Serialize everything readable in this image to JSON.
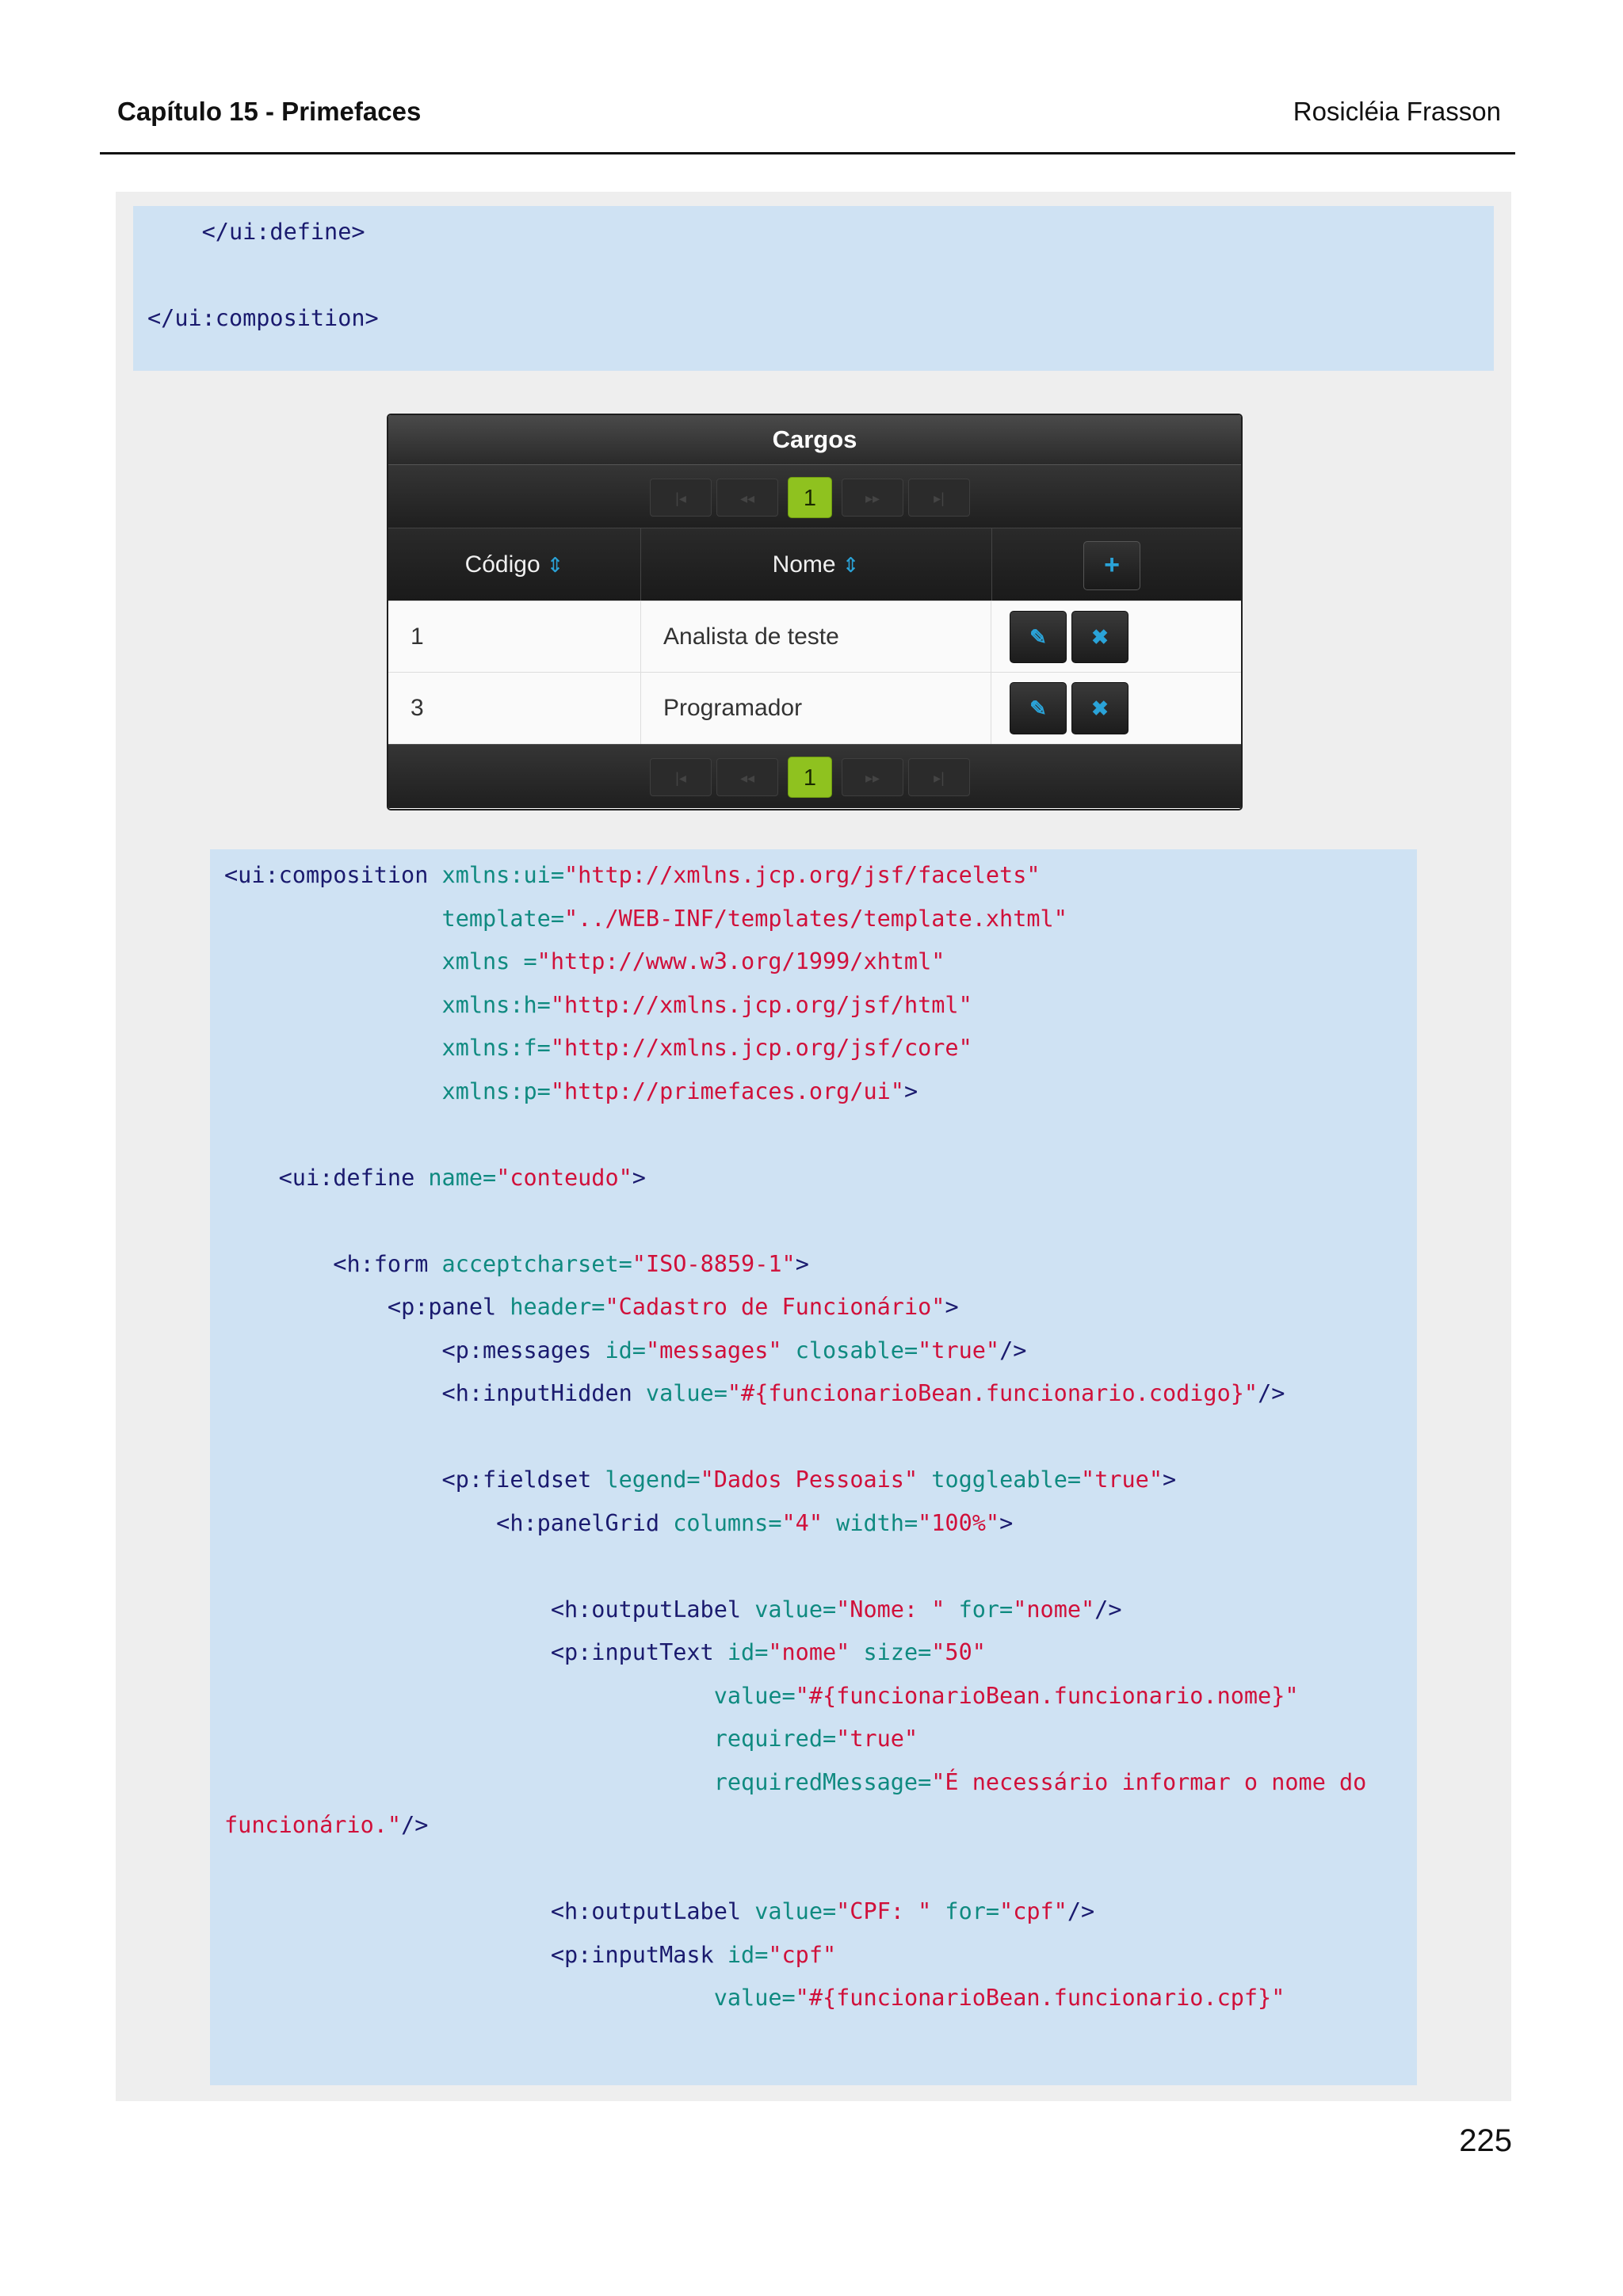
{
  "header": {
    "chapter": "Capítulo 15 - Primefaces",
    "author": "Rosicléia Frasson"
  },
  "code1": {
    "l1": "    </ui:define>",
    "l3": "</ui:composition>"
  },
  "datatable": {
    "title": "Cargos",
    "paginator": {
      "first_icon": "first-page-icon",
      "prev_icon": "prev-page-icon",
      "current_page": "1",
      "next_icon": "next-page-icon",
      "last_icon": "last-page-icon"
    },
    "columns": [
      "Código",
      "Nome"
    ],
    "add_icon": "plus-icon",
    "rows": [
      {
        "codigo": "1",
        "nome": "Analista de teste"
      },
      {
        "codigo": "3",
        "nome": "Programador"
      }
    ],
    "edit_icon": "pencil-icon",
    "delete_icon": "close-icon",
    "colors": {
      "current_page": "#8fc21f",
      "icon_accent": "#2aa3d8",
      "header_bg": "#2a2a2a"
    }
  },
  "code2": {
    "l1_t": "<ui:composition",
    "l1_a": " xmlns:ui=",
    "l1_v": "\"http://xmlns.jcp.org/jsf/facelets\"",
    "l2_a": "template=",
    "l2_v": "\"../WEB-INF/templates/template.xhtml\"",
    "l3_a": "xmlns =",
    "l3_v": "\"http://www.w3.org/1999/xhtml\"",
    "l4_a": "xmlns:h=",
    "l4_v": "\"http://xmlns.jcp.org/jsf/html\"",
    "l5_a": "xmlns:f=",
    "l5_v": "\"http://xmlns.jcp.org/jsf/core\"",
    "l6_a": "xmlns:p=",
    "l6_v": "\"http://primefaces.org/ui\"",
    "l6_t": ">",
    "l8_t": "<ui:define",
    "l8_a": " name=",
    "l8_v": "\"conteudo\"",
    "l8_t2": ">",
    "l10_t": "<h:form",
    "l10_a": " acceptcharset=",
    "l10_v": "\"ISO-8859-1\"",
    "l10_t2": ">",
    "l11_t": "<p:panel",
    "l11_a": " header=",
    "l11_v": "\"Cadastro de Funcionário\"",
    "l11_t2": ">",
    "l12_t": "<p:messages",
    "l12_a": " id=",
    "l12_v": "\"messages\"",
    "l12_a2": " closable=",
    "l12_v2": "\"true\"",
    "l12_t2": "/>",
    "l13_t": "<h:inputHidden",
    "l13_a": " value=",
    "l13_v": "\"#{funcionarioBean.funcionario.codigo}\"",
    "l13_t2": "/>",
    "l15_t": "<p:fieldset",
    "l15_a": " legend=",
    "l15_v": "\"Dados Pessoais\"",
    "l15_a2": " toggleable=",
    "l15_v2": "\"true\"",
    "l15_t2": ">",
    "l16_t": "<h:panelGrid",
    "l16_a": " columns=",
    "l16_v": "\"4\"",
    "l16_a2": " width=",
    "l16_v2": "\"100%\"",
    "l16_t2": ">",
    "l18_t": "<h:outputLabel",
    "l18_a": " value=",
    "l18_v": "\"Nome: \"",
    "l18_a2": " for=",
    "l18_v2": "\"nome\"",
    "l18_t2": "/>",
    "l19_t": "<p:inputText",
    "l19_a": " id=",
    "l19_v": "\"nome\"",
    "l19_a2": " size=",
    "l19_v2": "\"50\"",
    "l20_a": "value=",
    "l20_v": "\"#{funcionarioBean.funcionario.nome}\"",
    "l21_a": "required=",
    "l21_v": "\"true\"",
    "l22_a": "requiredMessage=",
    "l22_v": "\"É necessário informar o nome do",
    "l23_v": "funcionário.\"",
    "l23_t": "/>",
    "l25_t": "<h:outputLabel",
    "l25_a": " value=",
    "l25_v": "\"CPF: \"",
    "l25_a2": " for=",
    "l25_v2": "\"cpf\"",
    "l25_t2": "/>",
    "l26_t": "<p:inputMask",
    "l26_a": " id=",
    "l26_v": "\"cpf\"",
    "l27_a": "value=",
    "l27_v": "\"#{funcionarioBean.funcionario.cpf}\""
  },
  "page_number": "225"
}
